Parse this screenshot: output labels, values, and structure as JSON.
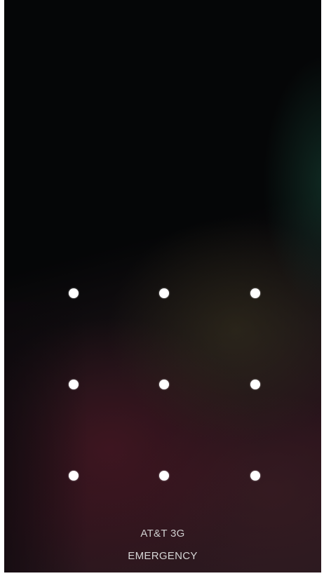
{
  "status": {
    "carrier_text": "AT&T 3G"
  },
  "actions": {
    "emergency_label": "EMERGENCY"
  },
  "pattern_lock": {
    "rows": 3,
    "columns": 3,
    "dot_color": "#ffffff"
  },
  "colors": {
    "background": "#040507",
    "text": "#cfcfcf"
  }
}
